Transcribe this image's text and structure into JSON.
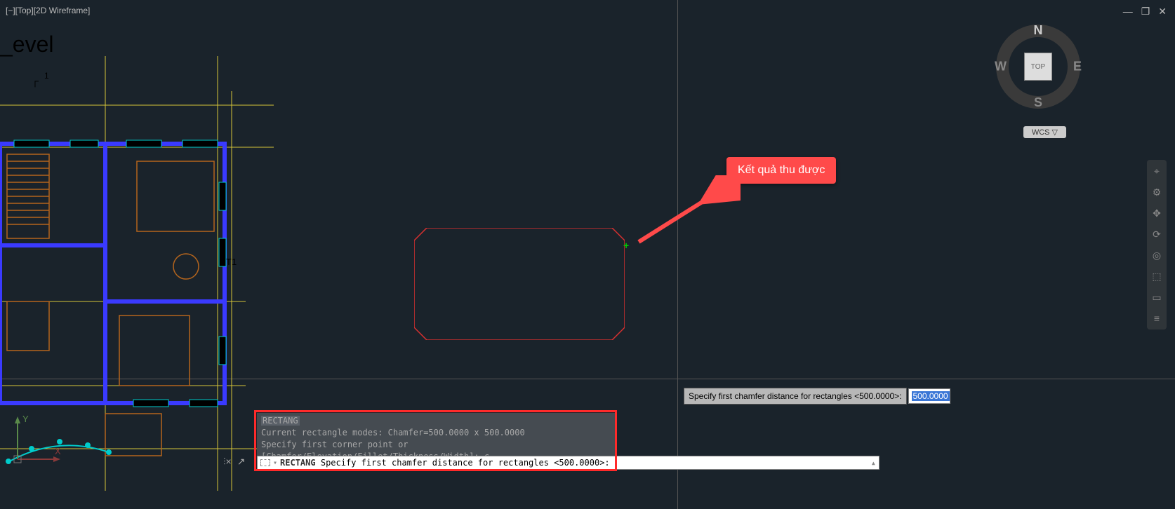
{
  "viewport": {
    "label": "[−][Top][2D Wireframe]"
  },
  "level_text": "_evel",
  "window_controls": {
    "min": "—",
    "restore": "❐",
    "close": "✕"
  },
  "viewcube": {
    "n": "N",
    "s": "S",
    "e": "E",
    "w": "W",
    "top": "TOP",
    "wcs": "WCS ▽"
  },
  "navbar_icons": [
    "⌖",
    "⚙",
    "✥",
    "⟳",
    "◎",
    "⬚",
    "▭",
    "≡"
  ],
  "dyn_prompt": {
    "label": "Specify first chamfer distance for rectangles <500.0000>:",
    "value": "500.0000"
  },
  "cmd_history": {
    "name": "RECTANG",
    "line1": "Current rectangle modes:  Chamfer=500.0000 x 500.0000",
    "line2": "Specify first corner point or [Chamfer/Elevation/Fillet/Thickness/Width]: c"
  },
  "cmd_line": {
    "command": "RECTANG",
    "prompt": "Specify first chamfer distance for rectangles <500.0000>:"
  },
  "callout": {
    "text": "Kết quả thu được"
  },
  "ucs": {
    "x": "X",
    "y": "Y"
  },
  "plan_marker": {
    "t1": "T1",
    "one": "1"
  }
}
